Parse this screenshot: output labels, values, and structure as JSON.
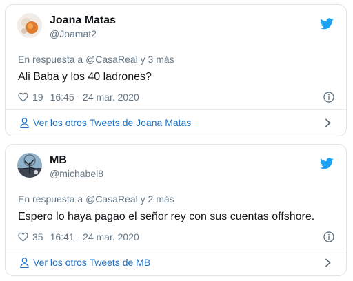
{
  "tweets": [
    {
      "display_name": "Joana Matas",
      "handle": "@Joamat2",
      "reply_prefix": "En respuesta a ",
      "reply_to": "@CasaReal",
      "reply_suffix": " y 3 más",
      "text": "Ali Baba y los 40 ladrones?",
      "likes": "19",
      "timestamp": "16:45 - 24 mar. 2020",
      "footer_link": "Ver los otros Tweets de Joana Matas",
      "avatar_icon": "flower-avatar"
    },
    {
      "display_name": "MB",
      "handle": "@michabel8",
      "reply_prefix": "En respuesta a ",
      "reply_to": "@CasaReal",
      "reply_suffix": " y 2 más",
      "text": "Espero lo haya pagao el señor rey con sus cuentas offshore.",
      "likes": "35",
      "timestamp": "16:41 - 24 mar. 2020",
      "footer_link": "Ver los otros Tweets de MB",
      "avatar_icon": "tree-avatar"
    }
  ],
  "colors": {
    "twitter_blue": "#1da1f2",
    "link_blue": "#1b6ec2",
    "secondary_text": "#657786",
    "border": "#dfe3e6"
  },
  "icons": [
    "twitter-bird-icon",
    "heart-icon",
    "info-icon",
    "user-icon",
    "chevron-right-icon"
  ]
}
